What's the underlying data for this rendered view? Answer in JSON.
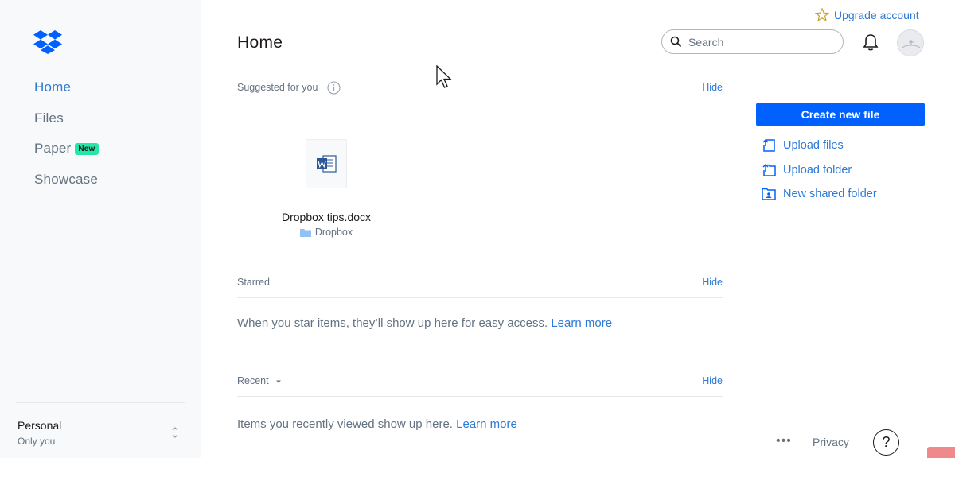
{
  "sidebar": {
    "items": [
      {
        "label": "Home",
        "active": true
      },
      {
        "label": "Files",
        "active": false
      },
      {
        "label": "Paper",
        "active": false,
        "badge": "New"
      },
      {
        "label": "Showcase",
        "active": false
      }
    ],
    "account": {
      "name": "Personal",
      "sub": "Only you"
    }
  },
  "header": {
    "title": "Home",
    "upgrade_label": "Upgrade account",
    "search_placeholder": "Search"
  },
  "sections": {
    "suggested": {
      "title": "Suggested for you",
      "hide": "Hide",
      "files": [
        {
          "name": "Dropbox tips.docx",
          "location": "Dropbox",
          "icon": "word-doc-icon"
        }
      ]
    },
    "starred": {
      "title": "Starred",
      "hide": "Hide",
      "empty_text": "When you star items, they’ll show up here for easy access.",
      "learn_more": "Learn more"
    },
    "recent": {
      "title": "Recent",
      "hide": "Hide",
      "empty_text": "Items you recently viewed show up here.",
      "learn_more": "Learn more"
    }
  },
  "actions": {
    "create_label": "Create new file",
    "items": [
      {
        "label": "Upload files",
        "icon": "upload-files-icon"
      },
      {
        "label": "Upload folder",
        "icon": "upload-folder-icon"
      },
      {
        "label": "New shared folder",
        "icon": "shared-folder-icon"
      }
    ]
  },
  "footer": {
    "more": "•••",
    "privacy": "Privacy",
    "help": "?"
  },
  "colors": {
    "accent": "#0061fe",
    "link": "#2e7ad6",
    "badge": "#24e6a8",
    "sidebar_bg": "#f7f9fa"
  }
}
